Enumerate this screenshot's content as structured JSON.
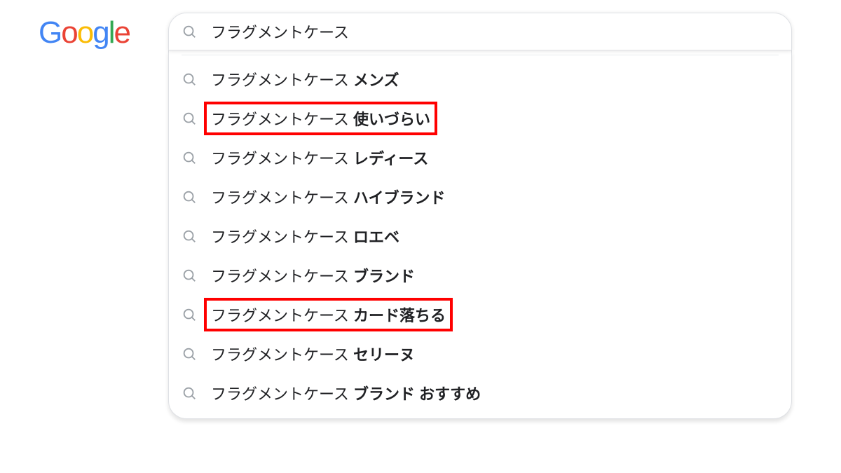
{
  "logo": {
    "text": "Google"
  },
  "search": {
    "query": "フラグメントケース",
    "suggestions": [
      {
        "base": "フラグメントケース ",
        "completion": "メンズ",
        "highlighted": false
      },
      {
        "base": "フラグメントケース ",
        "completion": "使いづらい",
        "highlighted": true
      },
      {
        "base": "フラグメントケース ",
        "completion": "レディース",
        "highlighted": false
      },
      {
        "base": "フラグメントケース ",
        "completion": "ハイブランド",
        "highlighted": false
      },
      {
        "base": "フラグメントケース ",
        "completion": "ロエベ",
        "highlighted": false
      },
      {
        "base": "フラグメントケース ",
        "completion": "ブランド",
        "highlighted": false
      },
      {
        "base": "フラグメントケース ",
        "completion": "カード落ちる",
        "highlighted": true
      },
      {
        "base": "フラグメントケース ",
        "completion": "セリーヌ",
        "highlighted": false
      },
      {
        "base": "フラグメントケース ",
        "completion": "ブランド おすすめ",
        "highlighted": false
      }
    ]
  }
}
